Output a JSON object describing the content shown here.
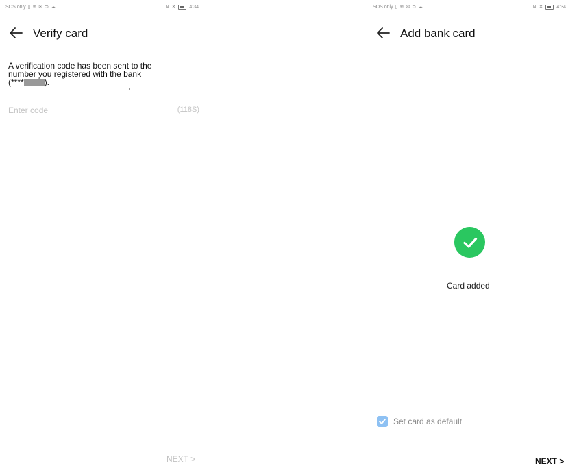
{
  "left_screen": {
    "status": {
      "left_text": "SOS only",
      "time": "4:34"
    },
    "header": {
      "title": "Verify card"
    },
    "message": {
      "line1": "A verification code has been sent to the",
      "line2": "number you registered with the bank",
      "mask_prefix": "(****",
      "mask_suffix": ")."
    },
    "code_field": {
      "placeholder": "Enter code",
      "value": "",
      "timer": "(118S)"
    },
    "footer": {
      "next_label": "NEXT",
      "next_arrow": ">"
    }
  },
  "right_screen": {
    "status": {
      "left_text": "SOS only",
      "time": "4:34"
    },
    "header": {
      "title": "Add bank card"
    },
    "success": {
      "text": "Card added",
      "icon": "check-circle-icon",
      "color": "#2ac760"
    },
    "default_option": {
      "label": "Set card as default",
      "checked": true
    },
    "footer": {
      "next_label": "NEXT",
      "next_arrow": ">"
    }
  },
  "colors": {
    "success": "#2ac760",
    "checkbox": "#8ec1f3",
    "disabled_text": "#c2c2c2",
    "primary_text": "#111111"
  }
}
